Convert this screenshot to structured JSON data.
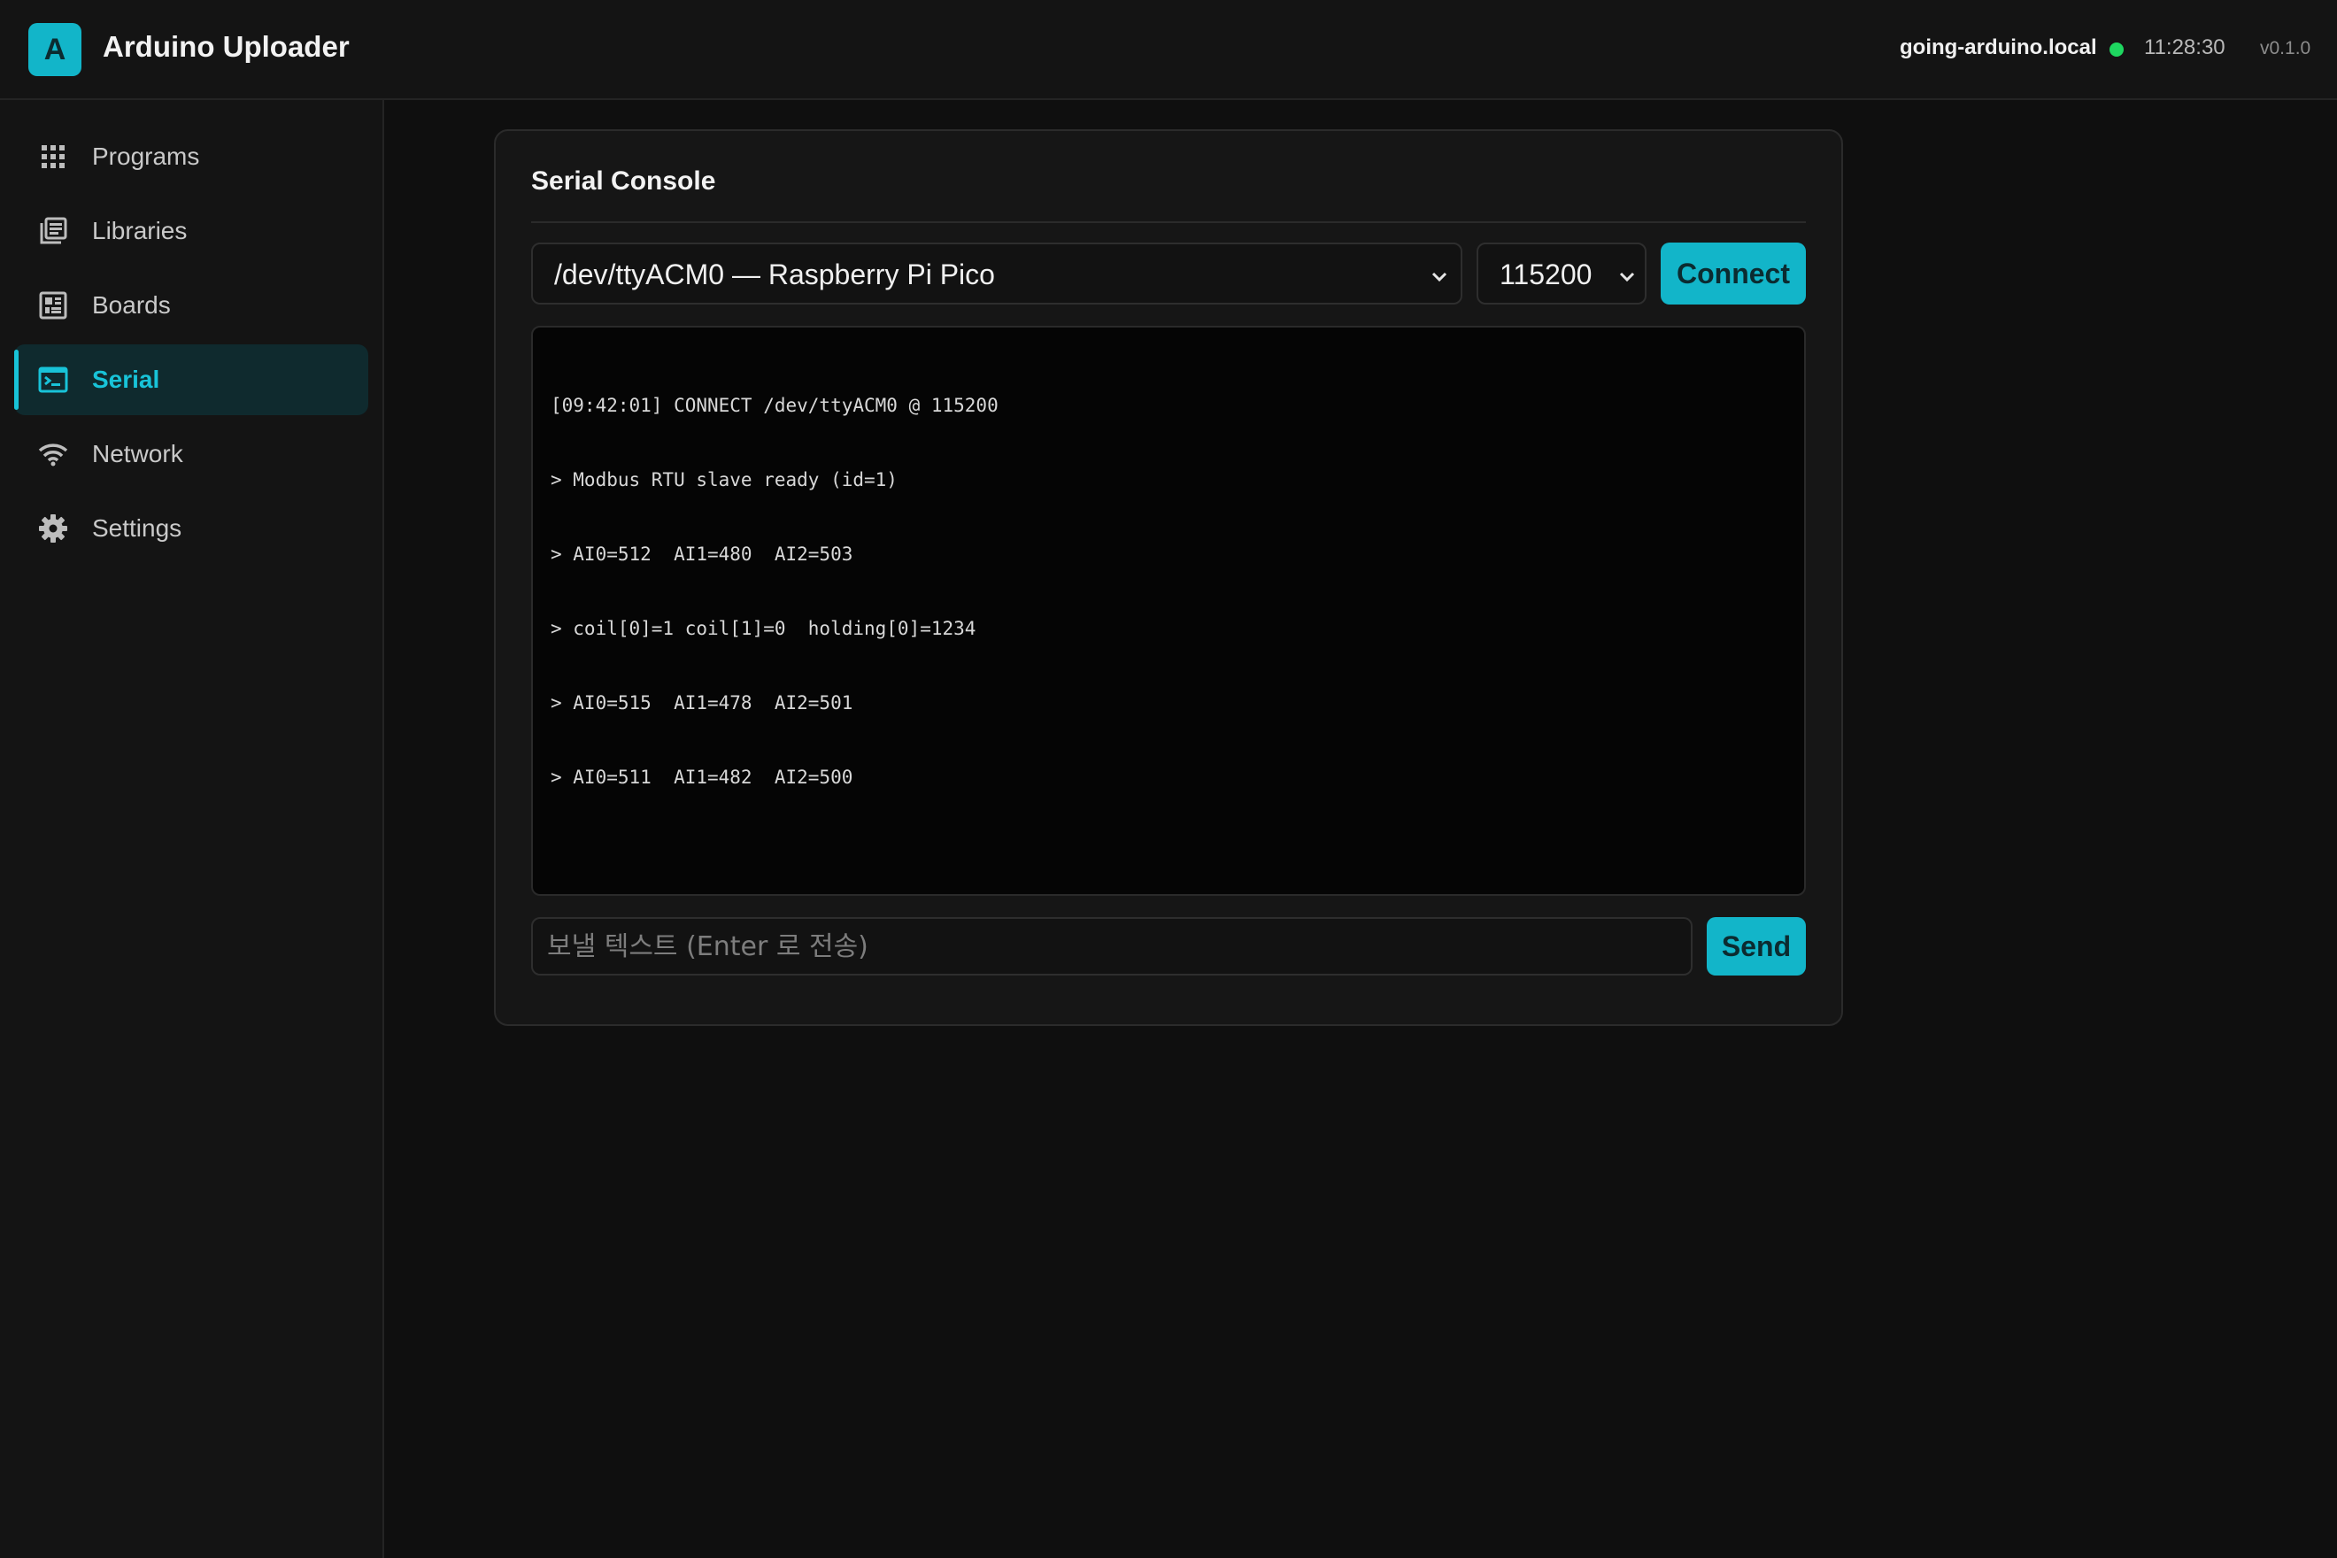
{
  "app": {
    "logo_letter": "A",
    "title": "Arduino Uploader",
    "host": "going-arduino.local",
    "connection_status": "online",
    "time": "11:28:30",
    "version": "v0.1.0",
    "accent_color": "#12b5c9",
    "status_color": "#1ed760"
  },
  "sidebar": {
    "items": [
      {
        "label": "Programs",
        "icon": "grid-icon",
        "active": false
      },
      {
        "label": "Libraries",
        "icon": "library-icon",
        "active": false
      },
      {
        "label": "Boards",
        "icon": "board-icon",
        "active": false
      },
      {
        "label": "Serial",
        "icon": "terminal-icon",
        "active": true
      },
      {
        "label": "Network",
        "icon": "wifi-icon",
        "active": false
      },
      {
        "label": "Settings",
        "icon": "gear-icon",
        "active": false
      }
    ]
  },
  "serial": {
    "title": "Serial Console",
    "port_selected": "/dev/ttyACM0 — Raspberry Pi Pico",
    "baud_selected": "115200",
    "connect_label": "Connect",
    "console_lines": [
      "[09:42:01] CONNECT /dev/ttyACM0 @ 115200",
      "> Modbus RTU slave ready (id=1)",
      "> AI0=512  AI1=480  AI2=503",
      "> coil[0]=1 coil[1]=0  holding[0]=1234",
      "> AI0=515  AI1=478  AI2=501",
      "> AI0=511  AI1=482  AI2=500"
    ],
    "input_placeholder": "보낼 텍스트 (Enter 로 전송)",
    "input_value": "",
    "send_label": "Send"
  }
}
